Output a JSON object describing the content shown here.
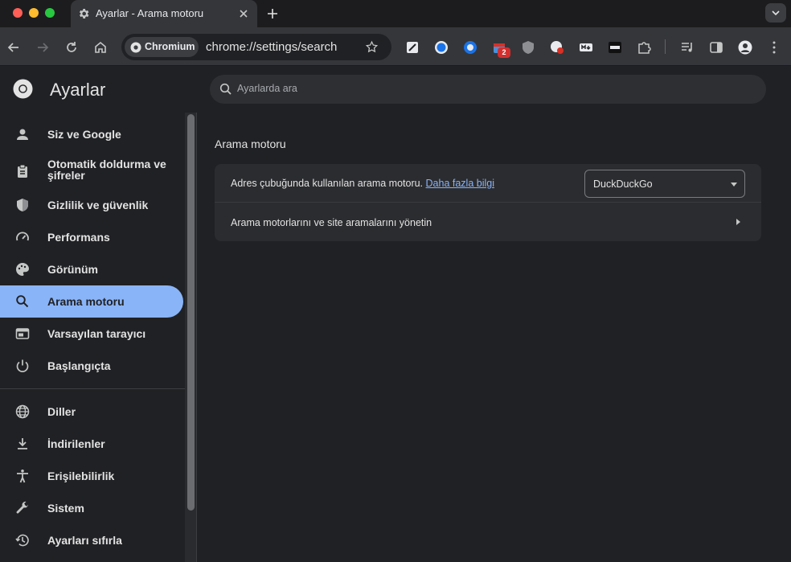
{
  "browser": {
    "tab_title": "Ayarlar - Arama motoru",
    "chip_label": "Chromium",
    "url": "chrome://settings/search",
    "extension_badge": "2"
  },
  "settings": {
    "title": "Ayarlar",
    "search_placeholder": "Ayarlarda ara"
  },
  "sidebar": {
    "items": [
      {
        "label": "Siz ve Google",
        "icon": "person-icon"
      },
      {
        "label": "Otomatik doldurma ve şifreler",
        "icon": "clipboard-icon"
      },
      {
        "label": "Gizlilik ve güvenlik",
        "icon": "shield-icon"
      },
      {
        "label": "Performans",
        "icon": "speedometer-icon"
      },
      {
        "label": "Görünüm",
        "icon": "palette-icon"
      },
      {
        "label": "Arama motoru",
        "icon": "search-icon",
        "active": true
      },
      {
        "label": "Varsayılan tarayıcı",
        "icon": "browser-window-icon"
      },
      {
        "label": "Başlangıçta",
        "icon": "power-icon"
      },
      {
        "label": "Diller",
        "icon": "globe-icon"
      },
      {
        "label": "İndirilenler",
        "icon": "download-icon"
      },
      {
        "label": "Erişilebilirlik",
        "icon": "accessibility-icon"
      },
      {
        "label": "Sistem",
        "icon": "wrench-icon"
      },
      {
        "label": "Ayarları sıfırla",
        "icon": "history-icon"
      }
    ]
  },
  "main": {
    "section_title": "Arama motoru",
    "row1_text": "Adres çubuğunda kullanılan arama motoru.",
    "row1_link": "Daha fazla bilgi",
    "engine_selected": "DuckDuckGo",
    "row2_text": "Arama motorlarını ve site aramalarını yönetin"
  },
  "colors": {
    "accent": "#8ab4f8",
    "background": "#202124",
    "card": "#2b2c2f"
  }
}
